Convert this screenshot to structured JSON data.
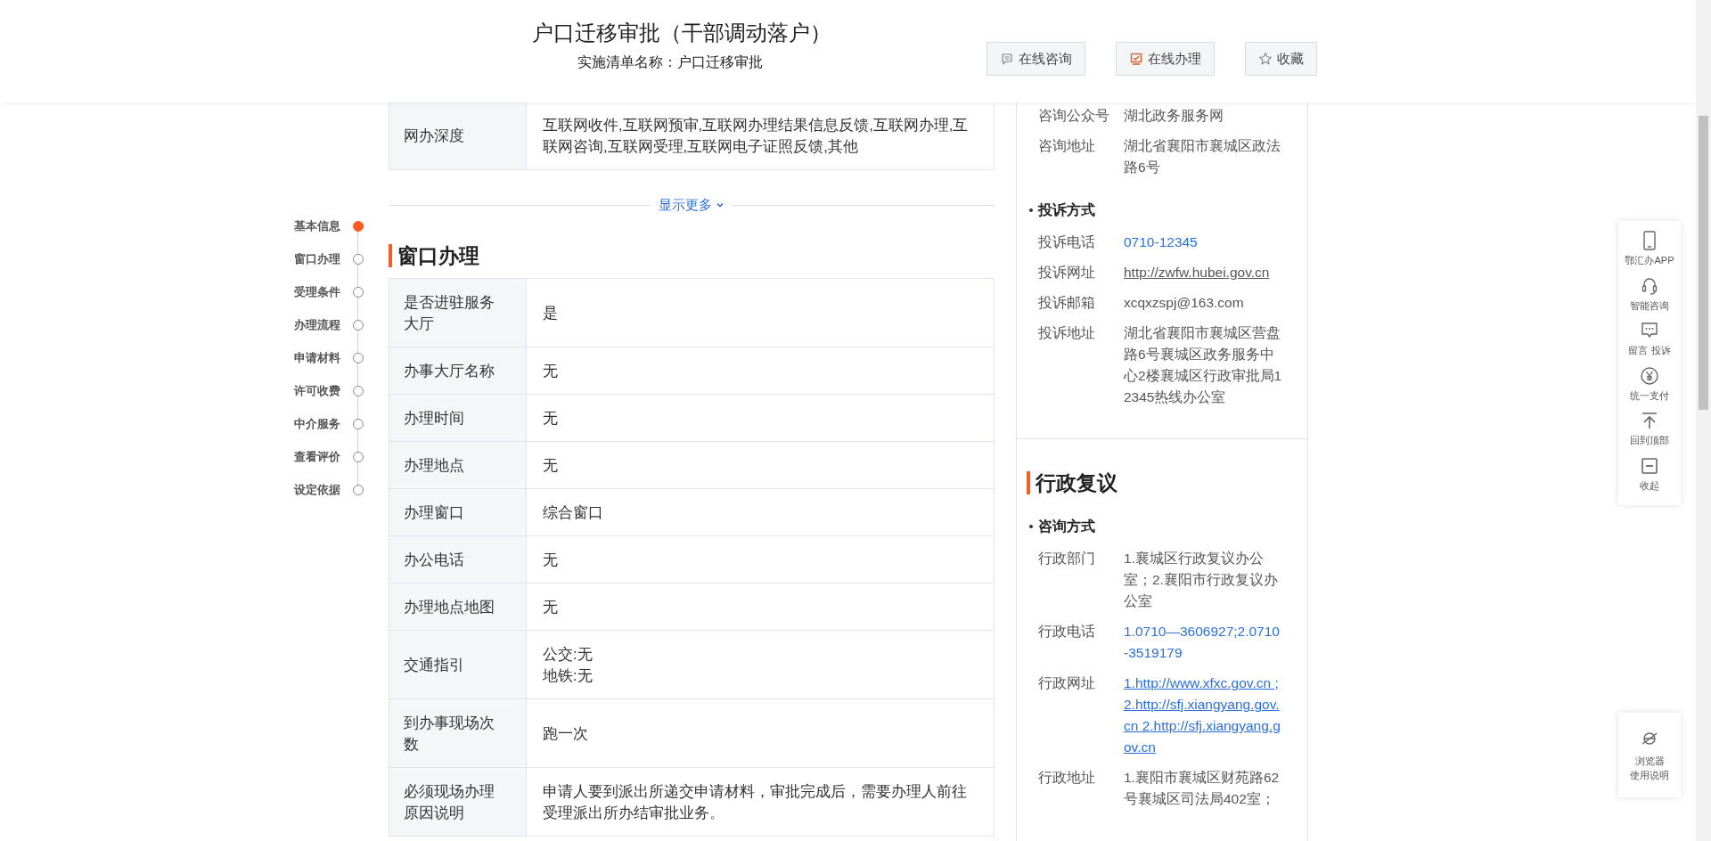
{
  "header": {
    "title": "户口迁移审批（干部调动落户）",
    "subtitle": "实施清单名称：户口迁移审批",
    "buttons": [
      {
        "label": "在线咨询",
        "kind": "consult"
      },
      {
        "label": "在线办理",
        "kind": "handle"
      },
      {
        "label": "收藏",
        "kind": "favorite"
      }
    ]
  },
  "nav": {
    "items": [
      {
        "label": "基本信息",
        "selected": true
      },
      {
        "label": "窗口办理",
        "selected": false
      },
      {
        "label": "受理条件",
        "selected": false
      },
      {
        "label": "办理流程",
        "selected": false
      },
      {
        "label": "申请材料",
        "selected": false
      },
      {
        "label": "许可收费",
        "selected": false
      },
      {
        "label": "中介服务",
        "selected": false
      },
      {
        "label": "查看评价",
        "selected": false
      },
      {
        "label": "设定依据",
        "selected": false
      }
    ]
  },
  "basic_table": {
    "rows": [
      {
        "label": "网办深度",
        "value": "互联网收件,互联网预审,互联网办理结果信息反馈,互联网办理,互联网咨询,互联网受理,互联网电子证照反馈,其他"
      }
    ]
  },
  "show_more": "显示更多",
  "window_section": {
    "title": "窗口办理",
    "rows": [
      {
        "label": "是否进驻服务大厅",
        "value": "是"
      },
      {
        "label": "办事大厅名称",
        "value": "无"
      },
      {
        "label": "办理时间",
        "value": "无"
      },
      {
        "label": "办理地点",
        "value": "无"
      },
      {
        "label": "办理窗口",
        "value": "综合窗口"
      },
      {
        "label": "办公电话",
        "value": "无"
      },
      {
        "label": "办理地点地图",
        "value": "无"
      },
      {
        "label": "交通指引",
        "lines": [
          "公交:无",
          "地铁:无"
        ]
      },
      {
        "label": "到办事现场次数",
        "value": "跑一次"
      },
      {
        "label": "必须现场办理原因说明",
        "value": "申请人要到派出所递交申请材料，审批完成后，需要办理人前往受理派出所办结审批业务。"
      }
    ]
  },
  "contact_panel": {
    "groups": [
      {
        "rows": [
          {
            "label": "咨询公众号",
            "value": "湖北政务服务网",
            "kind": "text"
          },
          {
            "label": "咨询地址",
            "value": "湖北省襄阳市襄城区政法路6号",
            "kind": "text"
          }
        ]
      },
      {
        "heading": "投诉方式",
        "rows": [
          {
            "label": "投诉电话",
            "value": "0710-12345",
            "kind": "phone"
          },
          {
            "label": "投诉网址",
            "value": "http://zwfw.hubei.gov.cn",
            "kind": "url"
          },
          {
            "label": "投诉邮箱",
            "value": "xcqxzspj@163.com",
            "kind": "text"
          },
          {
            "label": "投诉地址",
            "value": "湖北省襄阳市襄城区营盘路6号襄城区政务服务中心2楼襄城区行政审批局12345热线办公室",
            "kind": "text"
          }
        ]
      }
    ]
  },
  "review_panel": {
    "title": "行政复议",
    "groups": [
      {
        "heading": "咨询方式",
        "rows": [
          {
            "label": "行政部门",
            "value": "1.襄城区行政复议办公室；2.襄阳市行政复议办公室",
            "kind": "text"
          },
          {
            "label": "行政电话",
            "value": "1.0710—3606927;2.0710-3519179",
            "kind": "phone"
          },
          {
            "label": "行政网址",
            "value": "1.http://www.xfxc.gov.cn ;2.http://sfj.xiangyang.gov.cn 2.http://sfj.xiangyang.gov.cn",
            "kind": "link"
          },
          {
            "label": "行政地址",
            "value": "1.襄阳市襄城区财苑路62号襄城区司法局402室；",
            "kind": "text"
          }
        ]
      }
    ]
  },
  "side_toolbar": {
    "items": [
      {
        "label": "鄂汇办APP"
      },
      {
        "label": "智能咨询"
      },
      {
        "label": "留言 投诉"
      },
      {
        "label": "统一支付"
      },
      {
        "label": "回到顶部"
      },
      {
        "label": "收起"
      }
    ]
  },
  "browser_help": {
    "lines": [
      "浏览器",
      "使用说明"
    ]
  }
}
